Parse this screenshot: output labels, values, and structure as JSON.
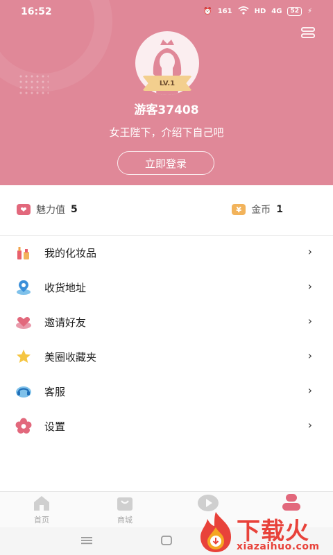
{
  "status_bar": {
    "time": "16:52",
    "net_speed": "161",
    "hd": "HD",
    "signal": "4G",
    "battery": "52"
  },
  "profile": {
    "level": "LV.1",
    "username": "游客37408",
    "intro": "女王陛下，介绍下自己吧",
    "login_label": "立即登录"
  },
  "stats": {
    "charm_label": "魅力值",
    "charm_value": "5",
    "coin_label": "金币",
    "coin_value": "1",
    "coin_symbol": "¥"
  },
  "menu": [
    {
      "label": "我的化妆品",
      "icon": "cosmetics-icon"
    },
    {
      "label": "收货地址",
      "icon": "location-icon"
    },
    {
      "label": "邀请好友",
      "icon": "invite-icon"
    },
    {
      "label": "美圈收藏夹",
      "icon": "star-icon"
    },
    {
      "label": "客服",
      "icon": "headset-icon"
    },
    {
      "label": "设置",
      "icon": "settings-flower-icon"
    }
  ],
  "tabs": [
    {
      "label": "首页",
      "icon": "home-icon"
    },
    {
      "label": "商城",
      "icon": "shop-bag-icon"
    },
    {
      "label": "",
      "icon": "video-play-icon"
    },
    {
      "label": "",
      "icon": "profile-icon"
    }
  ],
  "watermark": {
    "text": "下载火",
    "url": "xiazaihuo.com"
  },
  "colors": {
    "header_bg": "#e08898",
    "accent": "#e2687c",
    "coin": "#f2b35b",
    "watermark": "#e8423a"
  }
}
